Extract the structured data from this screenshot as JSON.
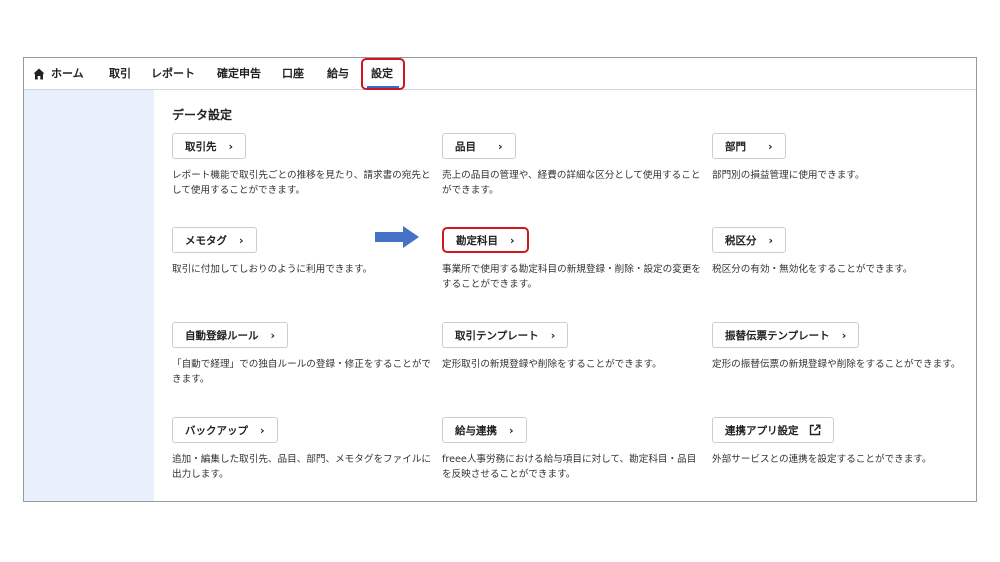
{
  "nav": {
    "home": "ホーム",
    "items": [
      "取引",
      "レポート",
      "確定申告",
      "口座",
      "給与",
      "設定"
    ]
  },
  "section_title": "データ設定",
  "cards": [
    {
      "label": "取引先",
      "desc": "レポート機能で取引先ごとの推移を見たり、請求書の宛先として使用することができます。"
    },
    {
      "label": "品目",
      "desc": "売上の品目の管理や、経費の詳細な区分として使用することができます。"
    },
    {
      "label": "部門",
      "desc": "部門別の損益管理に使用できます。"
    },
    {
      "label": "メモタグ",
      "desc": "取引に付加してしおりのように利用できます。"
    },
    {
      "label": "勘定科目",
      "desc": "事業所で使用する勘定科目の新規登録・削除・設定の変更をすることができます。"
    },
    {
      "label": "税区分",
      "desc": "税区分の有効・無効化をすることができます。"
    },
    {
      "label": "自動登録ルール",
      "desc": "「自動で経理」での独自ルールの登録・修正をすることができます。"
    },
    {
      "label": "取引テンプレート",
      "desc": "定形取引の新規登録や削除をすることができます。"
    },
    {
      "label": "振替伝票テンプレート",
      "desc": "定形の振替伝票の新規登録や削除をすることができます。"
    },
    {
      "label": "バックアップ",
      "desc": "追加・編集した取引先、品目、部門、メモタグをファイルに出力します。"
    },
    {
      "label": "給与連携",
      "desc": "freee人事労務における給与項目に対して、勘定科目・品目を反映させることができます。"
    },
    {
      "label": "連携アプリ設定",
      "desc": "外部サービスとの連携を設定することができます。"
    }
  ],
  "colors": {
    "highlight": "#d0161e",
    "arrow": "#4472c4",
    "sidebar": "#e8f1fb"
  },
  "icons": {
    "home": "home-icon",
    "chevron": "chevron-right-icon",
    "external": "external-link-icon",
    "arrow": "arrow-right-icon"
  }
}
